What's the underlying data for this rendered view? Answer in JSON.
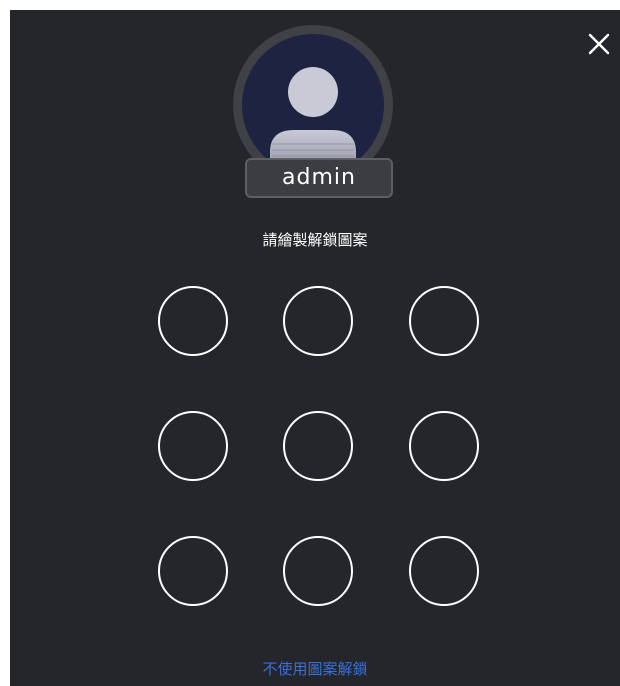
{
  "dialog": {
    "close_icon": "close-icon",
    "avatar_icon": "user-silhouette-icon",
    "username": "admin",
    "prompt": "請繪製解鎖圖案",
    "alt_unlock_link": "不使用圖案解鎖"
  },
  "pattern_grid": {
    "rows": 3,
    "cols": 3,
    "dots": [
      "1",
      "2",
      "3",
      "4",
      "5",
      "6",
      "7",
      "8",
      "9"
    ]
  },
  "colors": {
    "background": "#25262b",
    "avatar_ring": "#3f4146",
    "avatar_fill": "#1d2340",
    "dot_stroke": "#ffffff",
    "link": "#3a6fd8"
  }
}
